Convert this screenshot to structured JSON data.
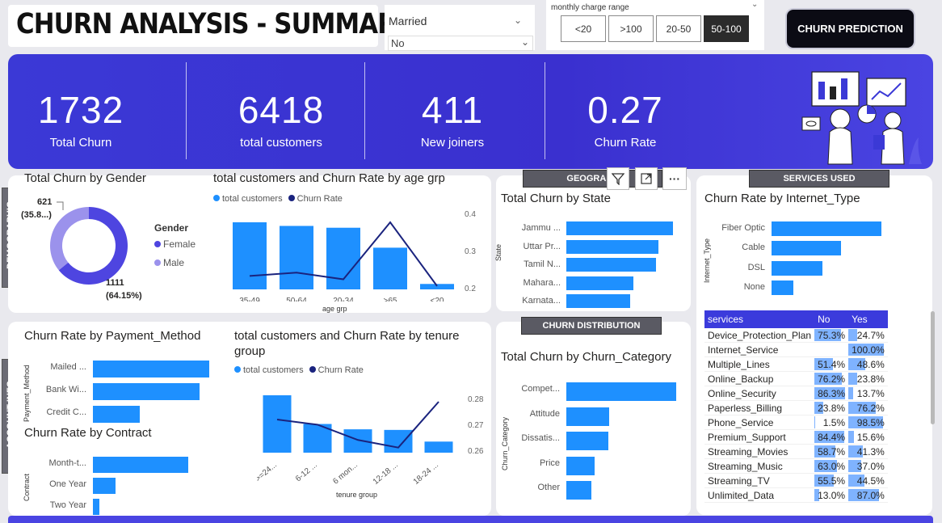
{
  "header": {
    "title": "CHURN ANALYSIS - SUMMARY",
    "married_slicer": {
      "label": "Married",
      "selected": "No"
    },
    "charge_range": {
      "label": "monthly charge range",
      "options": [
        "<20",
        ">100",
        "20-50",
        "50-100"
      ],
      "active": "50-100"
    },
    "prediction_button": "CHURN PREDICTION"
  },
  "kpis": [
    {
      "value": "1732",
      "label": "Total Churn"
    },
    {
      "value": "6418",
      "label": "total customers"
    },
    {
      "value": "411",
      "label": "New joiners"
    },
    {
      "value": "0.27",
      "label": "Churn Rate"
    }
  ],
  "sections": {
    "demographic": "DEMOGRAPHIC",
    "account_info": "ACCOUNT INFO",
    "geography": "GEOGRAPH",
    "churn_distribution": "CHURN DISTRIBUTION",
    "services_used": "SERVICES USED"
  },
  "colors": {
    "primary": "#1e90ff",
    "dark_line": "#1a237e",
    "band": "#3b39d6",
    "female": "#4e45e0",
    "male": "#9b92ec"
  },
  "gender_chart": {
    "title": "Total Churn by Gender",
    "legend_title": "Gender",
    "legend": [
      "Female",
      "Male"
    ],
    "female_label_1": "1111",
    "female_label_2": "(64.15%)",
    "male_label_1": "621",
    "male_label_2": "(35.8...)"
  },
  "age_chart": {
    "title": "total customers and Churn Rate by age grp",
    "legend": [
      "total customers",
      "Churn Rate"
    ],
    "xlabel": "age grp",
    "right_ticks": [
      "0.4",
      "0.3",
      "0.2"
    ]
  },
  "state_chart": {
    "title": "Total Churn by State",
    "ylabel": "State"
  },
  "internet_chart": {
    "title": "Churn Rate by Internet_Type",
    "ylabel": "Internet_Type"
  },
  "payment_chart": {
    "title": "Churn Rate by Payment_Method",
    "ylabel": "Payment_Method"
  },
  "contract_chart": {
    "title": "Churn Rate by Contract",
    "ylabel": "Contract"
  },
  "tenure_chart": {
    "title_1": "total customers and Churn Rate by tenure",
    "title_2": "group",
    "legend": [
      "total customers",
      "Churn Rate"
    ],
    "xlabel": "tenure group",
    "right_ticks": [
      "0.28",
      "0.27",
      "0.26"
    ]
  },
  "category_chart": {
    "title": "Total Churn by Churn_Category",
    "ylabel": "Churn_Category"
  },
  "services_table": {
    "headers": [
      "services",
      "No",
      "Yes"
    ],
    "rows": [
      {
        "name": "Device_Protection_Plan",
        "no": "75.3%",
        "yes": "24.7%",
        "no_v": 75.3,
        "yes_v": 24.7
      },
      {
        "name": "Internet_Service",
        "no": "",
        "yes": "100.0%",
        "no_v": 0,
        "yes_v": 100
      },
      {
        "name": "Multiple_Lines",
        "no": "51.4%",
        "yes": "48.6%",
        "no_v": 51.4,
        "yes_v": 48.6
      },
      {
        "name": "Online_Backup",
        "no": "76.2%",
        "yes": "23.8%",
        "no_v": 76.2,
        "yes_v": 23.8
      },
      {
        "name": "Online_Security",
        "no": "86.3%",
        "yes": "13.7%",
        "no_v": 86.3,
        "yes_v": 13.7
      },
      {
        "name": "Paperless_Billing",
        "no": "23.8%",
        "yes": "76.2%",
        "no_v": 23.8,
        "yes_v": 76.2
      },
      {
        "name": "Phone_Service",
        "no": "1.5%",
        "yes": "98.5%",
        "no_v": 1.5,
        "yes_v": 98.5
      },
      {
        "name": "Premium_Support",
        "no": "84.4%",
        "yes": "15.6%",
        "no_v": 84.4,
        "yes_v": 15.6
      },
      {
        "name": "Streaming_Movies",
        "no": "58.7%",
        "yes": "41.3%",
        "no_v": 58.7,
        "yes_v": 41.3
      },
      {
        "name": "Streaming_Music",
        "no": "63.0%",
        "yes": "37.0%",
        "no_v": 63.0,
        "yes_v": 37.0
      },
      {
        "name": "Streaming_TV",
        "no": "55.5%",
        "yes": "44.5%",
        "no_v": 55.5,
        "yes_v": 44.5
      },
      {
        "name": "Unlimited_Data",
        "no": "13.0%",
        "yes": "87.0%",
        "no_v": 13.0,
        "yes_v": 87.0
      }
    ]
  },
  "chart_data": [
    {
      "type": "pie",
      "title": "Total Churn by Gender",
      "categories": [
        "Female",
        "Male"
      ],
      "values": [
        1111,
        621
      ],
      "labels": [
        "1111 (64.15%)",
        "621 (35.8...)"
      ]
    },
    {
      "type": "bar",
      "title": "total customers and Churn Rate by age grp",
      "xlabel": "age grp",
      "categories": [
        "35-49",
        "50-64",
        "20-34",
        ">65",
        "<20"
      ],
      "series": [
        {
          "name": "total customers",
          "values": [
            1850,
            1750,
            1700,
            1150,
            150
          ]
        },
        {
          "name": "Churn Rate",
          "values": [
            0.24,
            0.25,
            0.23,
            0.4,
            0.21
          ]
        }
      ],
      "y2lim": [
        0.2,
        0.4
      ]
    },
    {
      "type": "bar",
      "orientation": "horizontal",
      "title": "Total Churn by State",
      "ylabel": "State",
      "categories": [
        "Jammu ...",
        "Uttar Pr...",
        "Tamil N...",
        "Mahara...",
        "Karnata..."
      ],
      "values": [
        200,
        173,
        168,
        125,
        120
      ]
    },
    {
      "type": "bar",
      "orientation": "horizontal",
      "title": "Churn Rate by Internet_Type",
      "ylabel": "Internet_Type",
      "categories": [
        "Fiber Optic",
        "Cable",
        "DSL",
        "None"
      ],
      "values": [
        0.41,
        0.26,
        0.19,
        0.08
      ]
    },
    {
      "type": "bar",
      "orientation": "horizontal",
      "title": "Churn Rate by Payment_Method",
      "ylabel": "Payment_Method",
      "categories": [
        "Mailed ...",
        "Bank Wi...",
        "Credit C..."
      ],
      "values": [
        0.37,
        0.34,
        0.15
      ]
    },
    {
      "type": "bar",
      "orientation": "horizontal",
      "title": "Churn Rate by Contract",
      "ylabel": "Contract",
      "categories": [
        "Month-t...",
        "One Year",
        "Two Year"
      ],
      "values": [
        0.46,
        0.11,
        0.03
      ]
    },
    {
      "type": "bar",
      "title": "total customers and Churn Rate by tenure group",
      "xlabel": "tenure group",
      "categories": [
        ">=24...",
        "6-12 ...",
        "6 mon...",
        "12-18 ...",
        "18-24 ..."
      ],
      "series": [
        {
          "name": "total customers",
          "values": [
            2900,
            1450,
            1180,
            1150,
            560
          ]
        },
        {
          "name": "Churn Rate",
          "values": [
            0.273,
            0.271,
            0.265,
            0.262,
            0.28
          ]
        }
      ],
      "y2lim": [
        0.26,
        0.28
      ]
    },
    {
      "type": "bar",
      "orientation": "horizontal",
      "title": "Total Churn by Churn_Category",
      "ylabel": "Churn_Category",
      "categories": [
        "Compet...",
        "Attitude",
        "Dissatis...",
        "Price",
        "Other"
      ],
      "values": [
        760,
        295,
        290,
        196,
        176
      ]
    }
  ]
}
